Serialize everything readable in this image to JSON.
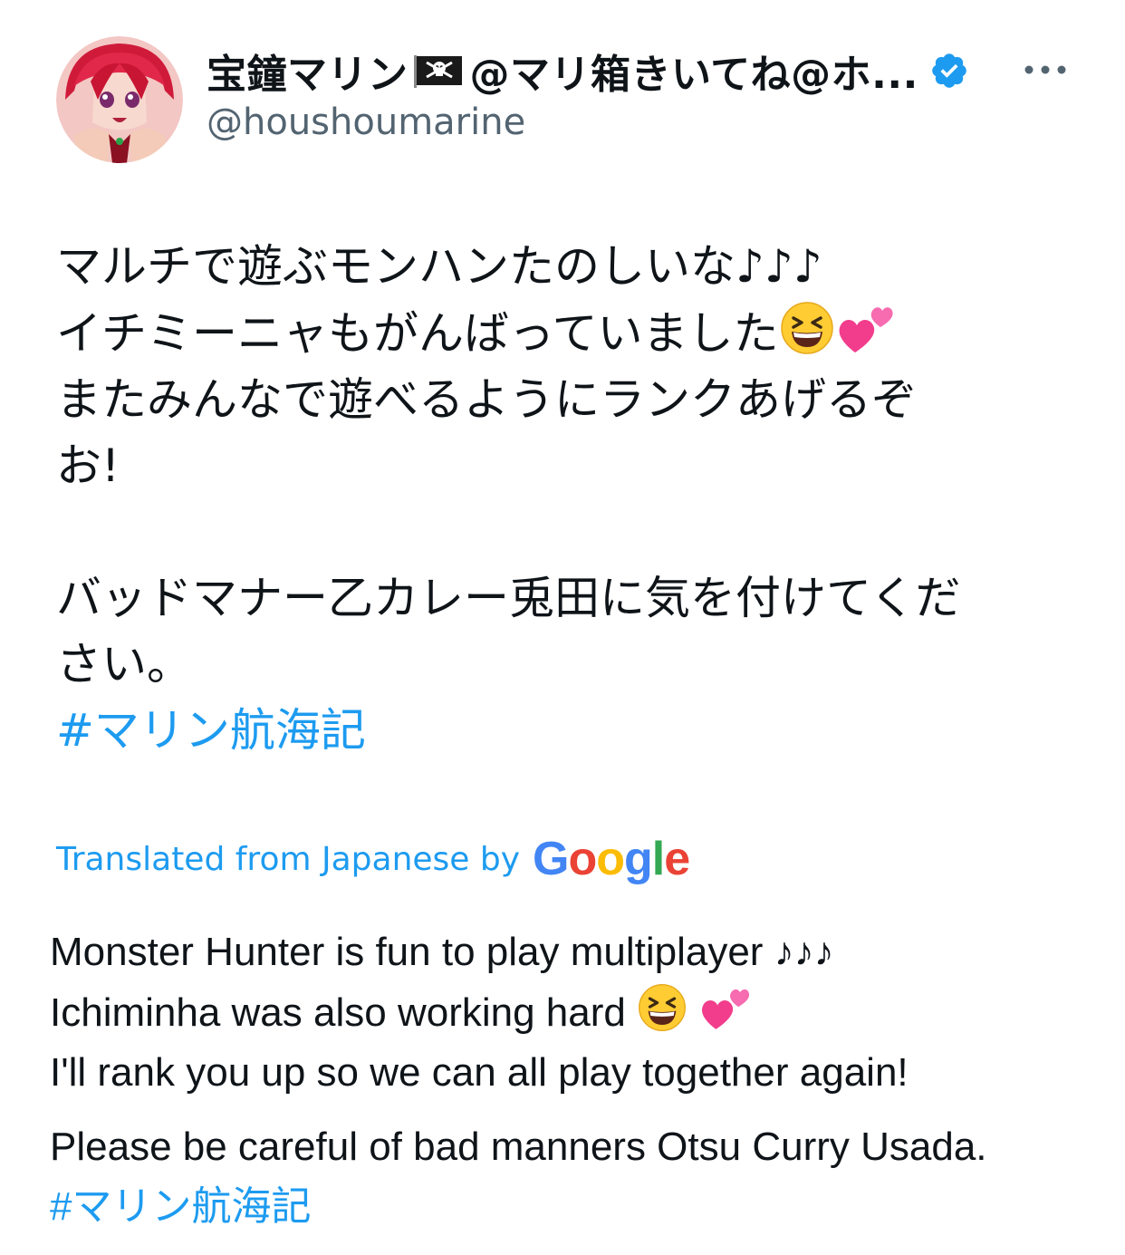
{
  "author": {
    "display_name": "宝鐘マリン",
    "display_name_suffix": " @マリ箱きいてね@ホ...",
    "handle": "@houshoumarine",
    "flag_icon": "pirate-flag-icon",
    "verified_icon": "verified-badge-icon",
    "verified_color": "#1d9bf0"
  },
  "tweet": {
    "line1": "マルチで遊ぶモンハンたのしいな♪♪♪",
    "line2": "イチミーニャもがんばっていました",
    "line3": "またみんなで遊べるようにランクあげるぞ",
    "line4": "お!",
    "line5": "バッドマナー乙カレー兎田に気を付けてくだ",
    "line6": "さい。",
    "hashtag": "#マリン航海記"
  },
  "translation": {
    "label": "Translated from Japanese by",
    "provider_logo": "Google",
    "line1": "Monster Hunter is fun to play multiplayer ♪♪♪",
    "line2": "Ichiminha was also working hard",
    "line3": "I'll rank you up so we can all play together again!",
    "line4": "Please be careful of bad manners Otsu Curry Usada.",
    "hashtag": "#マリン航海記"
  },
  "icons": {
    "more": "more-options-icon",
    "emoji_laugh": "grinning-squinting-face-icon",
    "emoji_hearts": "two-hearts-icon"
  },
  "colors": {
    "accent": "#1d9bf0",
    "secondary_text": "#536471",
    "text": "#0f1419"
  }
}
